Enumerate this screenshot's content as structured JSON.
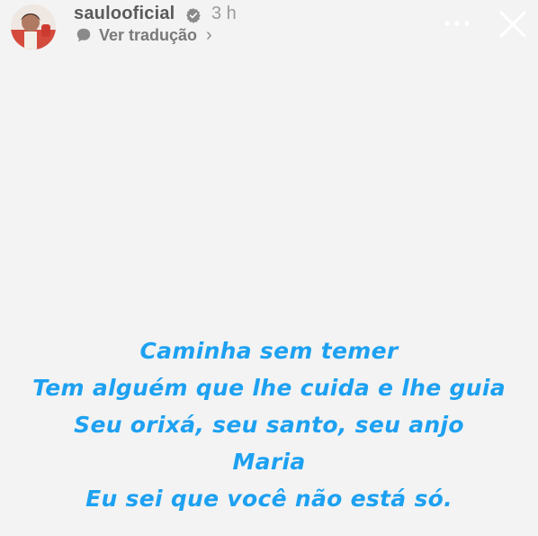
{
  "header": {
    "username": "saulooficial",
    "time": "3 h",
    "translate_label": "Ver tradução",
    "chevron": "›"
  },
  "icons": {
    "verified": "verified-badge-icon",
    "translate": "translate-bubble-icon",
    "more": "more-dots-icon",
    "close": "close-icon"
  },
  "story": {
    "lines": [
      "Caminha sem temer",
      "Tem alguém que lhe cuida e lhe guia",
      "Seu orixá, seu santo, seu anjo",
      "Maria",
      "Eu sei que você não está só."
    ]
  },
  "colors": {
    "background": "#f3f3f3",
    "text_accent": "#1da1f2",
    "username": "#5a5a5a",
    "muted": "#9a9a9a"
  }
}
